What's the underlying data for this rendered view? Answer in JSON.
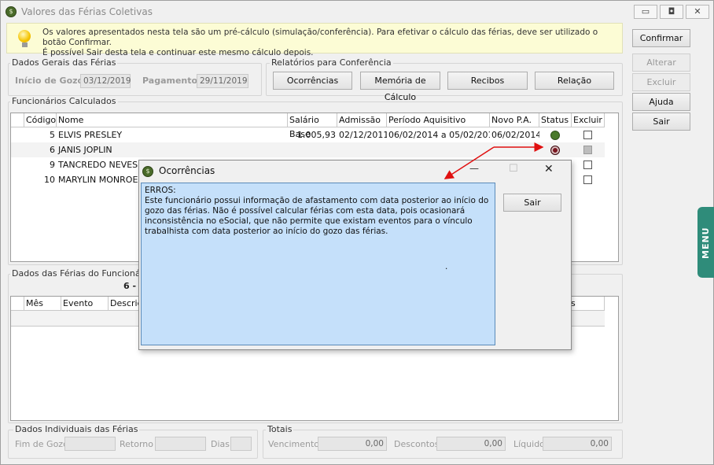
{
  "window": {
    "title": "Valores das Férias Coletivas",
    "app_icon": "app-logo-icon",
    "min_label": "▭",
    "max_label": "◘",
    "close_label": "✕"
  },
  "info": {
    "line1": "Os valores apresentados nesta tela são um pré-cálculo (simulação/conferência). Para efetivar o cálculo das férias, deve ser utilizado o botão Confirmar.",
    "line2": "É possível Sair desta tela e continuar este mesmo cálculo depois.",
    "icon": "lightbulb-icon"
  },
  "side_buttons": {
    "confirmar": "Confirmar",
    "alterar": "Alterar",
    "excluir": "Excluir",
    "ajuda": "Ajuda",
    "sair": "Sair"
  },
  "dados_gerais": {
    "title": "Dados Gerais das Férias",
    "inicio_label": "Início de Gozo",
    "inicio_value": "03/12/2019",
    "pagamento_label": "Pagamento",
    "pagamento_value": "29/11/2019"
  },
  "relatorios": {
    "title": "Relatórios para Conferência",
    "ocorrencias": "Ocorrências",
    "memoria": "Memória de Cálculo",
    "recibos": "Recibos",
    "relacao": "Relação"
  },
  "funcionarios": {
    "title": "Funcionários Calculados",
    "columns": [
      "Código",
      "Nome",
      "Salário Base",
      "Admissão",
      "Período Aquisitivo",
      "Novo P.A.",
      "Status",
      "Excluir"
    ],
    "rows": [
      {
        "codigo": "5",
        "nome": "ELVIS PRESLEY",
        "salario": "1.005,93",
        "admissao": "02/12/2011",
        "periodo": "06/02/2014 a 05/02/2015",
        "novo_pa": "06/02/2014",
        "status_color": "#4a7a2c",
        "excluir_enabled": true
      },
      {
        "codigo": "6",
        "nome": "JANIS JOPLIN",
        "salario": "",
        "admissao": "",
        "periodo": "",
        "novo_pa": "",
        "status_color": "#7a1620",
        "excluir_enabled": false
      },
      {
        "codigo": "9",
        "nome": "TANCREDO NEVES",
        "salario": "",
        "admissao": "",
        "periodo": "",
        "novo_pa": "",
        "status_color": "#6a6a6a",
        "excluir_enabled": true
      },
      {
        "codigo": "10",
        "nome": "MARYLIN MONROE",
        "salario": "",
        "admissao": "",
        "periodo": "",
        "novo_pa": "",
        "status_color": "",
        "excluir_enabled": true
      }
    ]
  },
  "dados_funcionario": {
    "title": "Dados das Férias do Funcionário",
    "selected": "6 - J",
    "columns": [
      "Mês",
      "Evento",
      "Descriç"
    ],
    "columns_right": "s"
  },
  "individuais": {
    "title": "Dados Individuais das Férias",
    "fim_label": "Fim de Gozo",
    "retorno_label": "Retorno",
    "dias_label": "Dias"
  },
  "totais": {
    "title": "Totais",
    "vencimentos_label": "Vencimentos",
    "vencimentos_value": "0,00",
    "descontos_label": "Descontos",
    "descontos_value": "0,00",
    "liquido_label": "Líquido",
    "liquido_value": "0,00"
  },
  "dialog": {
    "title": "Ocorrências",
    "icon": "app-logo-icon",
    "minimize": "—",
    "maximize": "☐",
    "close": "✕",
    "heading": "ERROS:",
    "message": "Este funcionário possui informação de afastamento com data posterior ao início do gozo das férias. Não é possível calcular férias com esta data, pois ocasionará inconsistência no eSocial, que não permite que existam eventos para o vínculo trabalhista com data posterior ao início do gozo das férias.",
    "dot": ".",
    "sair": "Sair"
  },
  "menu_tab": {
    "label": "MENU"
  },
  "colors": {
    "info_bg": "#fcfcd5",
    "dialog_text_bg": "#c5e0fa",
    "arrow": "#e01010",
    "menu_tab": "#2f8c7a"
  }
}
